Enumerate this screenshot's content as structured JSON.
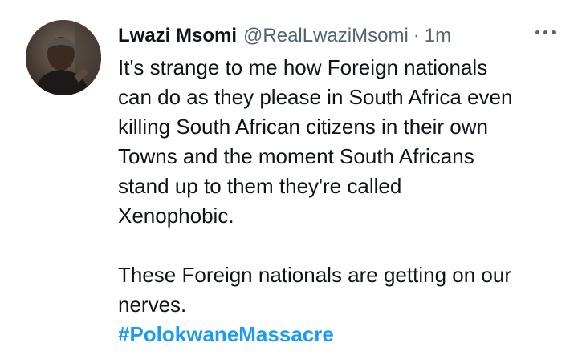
{
  "tweet": {
    "display_name": "Lwazi Msomi",
    "handle": "@RealLwaziMsomi",
    "separator": "·",
    "time": "1m",
    "more_icon": "more-horizontal-icon",
    "avatar_icon": "user-avatar",
    "paragraph_1_lines": [
      "It's strange to me how Foreign nationals",
      "can do as they please in South Africa even",
      "killing South African citizens in their own",
      "Towns and the moment South Africans",
      "stand up to them they're called",
      "Xenophobic."
    ],
    "paragraph_2_lines": [
      "These Foreign nationals are getting on our",
      "nerves."
    ],
    "hashtag": "#PolokwaneMassacre",
    "colors": {
      "text": "#0f1419",
      "secondary": "#536471",
      "link": "#1d9bf0"
    }
  }
}
